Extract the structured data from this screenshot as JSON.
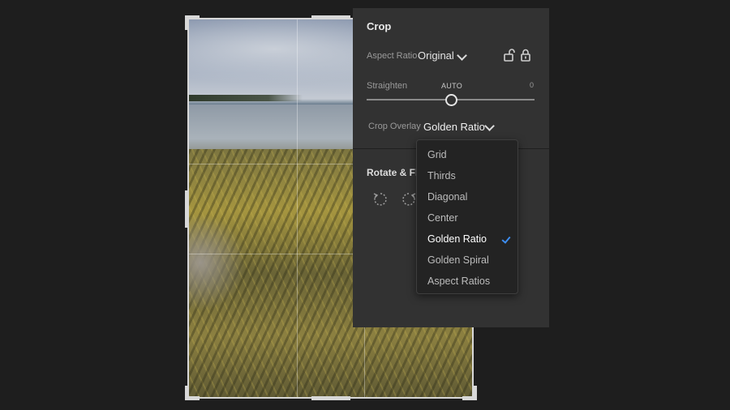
{
  "panel": {
    "title": "Crop",
    "aspect_ratio": {
      "label": "Aspect Ratio",
      "value": "Original"
    },
    "straighten": {
      "label": "Straighten",
      "auto": "AUTO",
      "value": "0",
      "level": 0.5
    },
    "crop_overlay": {
      "label": "Crop Overlay",
      "value": "Golden Ratio"
    },
    "rotate_flip": {
      "title": "Rotate & Flip"
    }
  },
  "overlay_menu": {
    "items": [
      "Grid",
      "Thirds",
      "Diagonal",
      "Center",
      "Golden Ratio",
      "Golden Spiral",
      "Aspect Ratios"
    ],
    "selected": "Golden Ratio"
  },
  "colors": {
    "panel_bg": "#323232",
    "menu_bg": "#232323",
    "accent_check": "#3d8df0"
  },
  "icons": [
    "lock-open-icon",
    "lock-icon",
    "rotate-left-icon",
    "rotate-right-icon",
    "chevron-down-icon",
    "checkmark-icon"
  ]
}
